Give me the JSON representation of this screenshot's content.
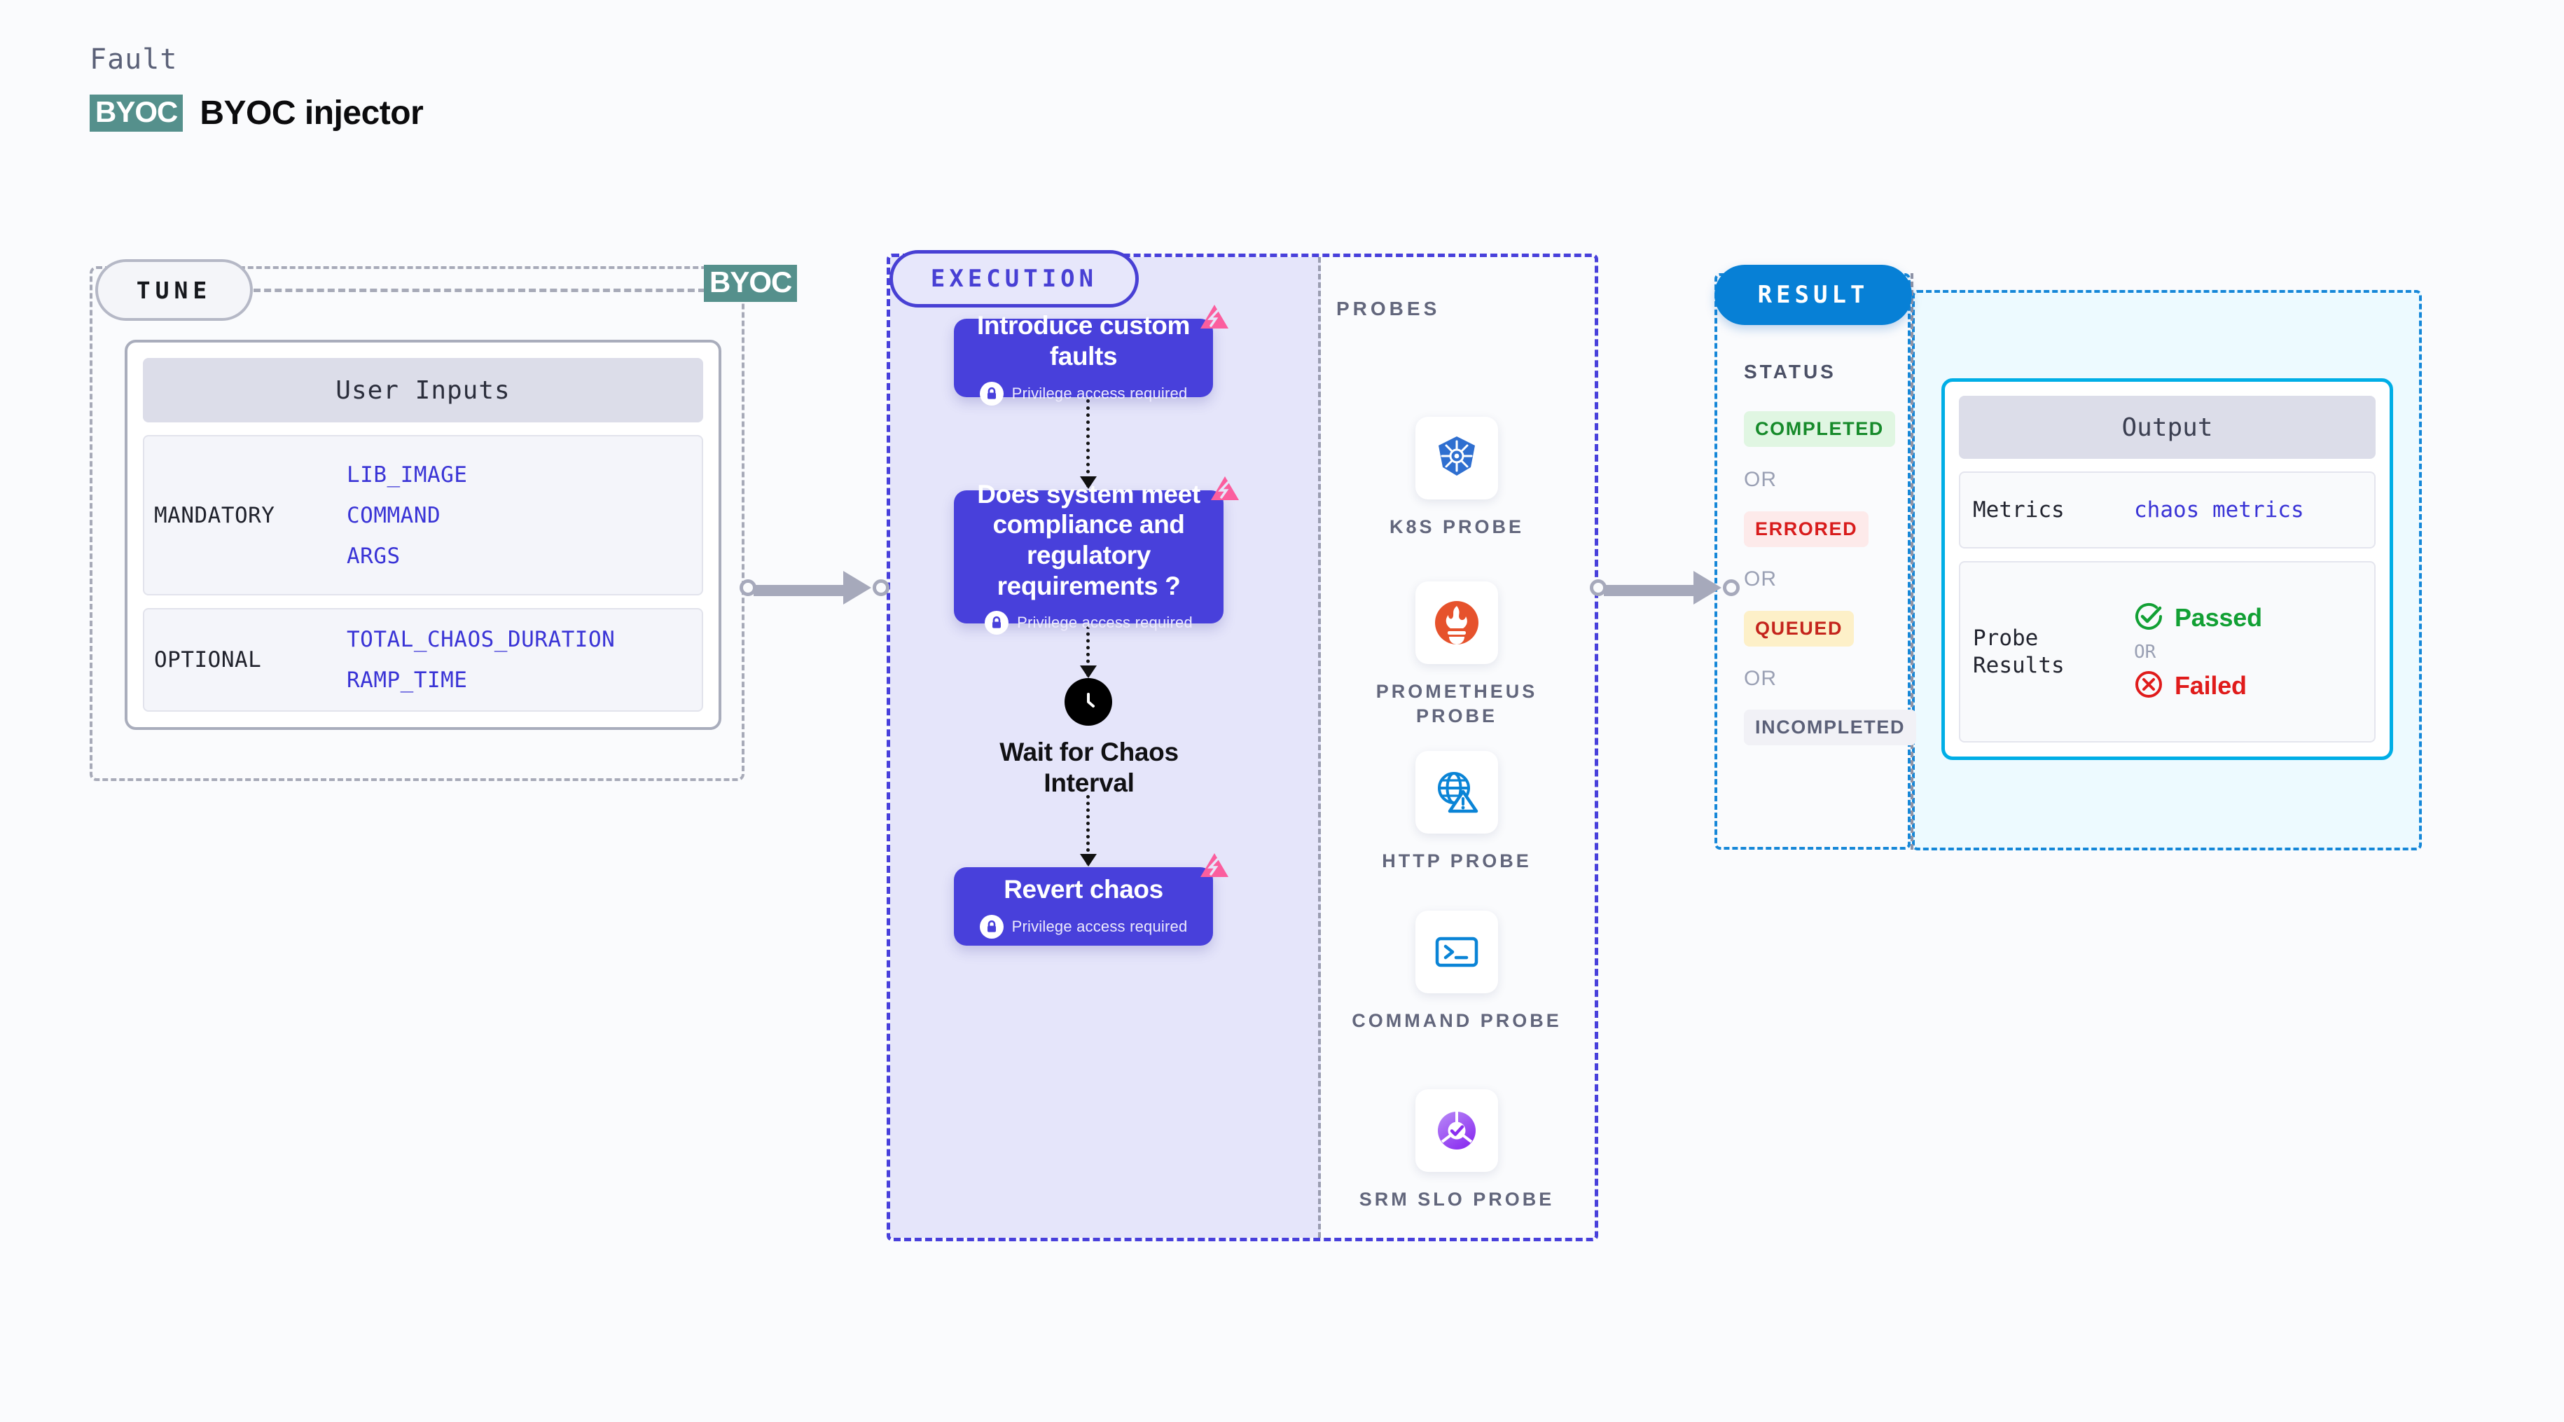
{
  "header": {
    "eyebrow": "Fault",
    "logo_badge": "BYOC",
    "title": "BYOC injector",
    "logo_color": "#55908c"
  },
  "tune": {
    "pill_label": "TUNE",
    "edge_tag": "BYOC",
    "card_header": "User Inputs",
    "groups": [
      {
        "kind": "MANDATORY",
        "values": [
          "LIB_IMAGE",
          "COMMAND",
          "ARGS"
        ]
      },
      {
        "kind": "OPTIONAL",
        "values": [
          "TOTAL_CHAOS_DURATION",
          "RAMP_TIME"
        ]
      }
    ],
    "value_color": "#3a34d6"
  },
  "execution": {
    "pill_label": "EXECUTION",
    "accent_color": "#4840db",
    "privilege_note": "Privilege access required",
    "nodes": [
      {
        "title": "Introduce custom faults",
        "privileged": true,
        "chaos_tag": true
      },
      {
        "title": "Does system meet compliance and regulatory requirements ?",
        "privileged": true,
        "chaos_tag": true
      },
      {
        "title": "Revert chaos",
        "privileged": true,
        "chaos_tag": true
      }
    ],
    "wait_step": {
      "label": "Wait for Chaos Interval",
      "icon": "clock-icon"
    }
  },
  "probes": {
    "section_label": "PROBES",
    "items": [
      {
        "label": "K8S PROBE",
        "icon": "kubernetes-icon",
        "color": "#2f6fd0"
      },
      {
        "label": "PROMETHEUS PROBE",
        "icon": "prometheus-icon",
        "color": "#e6522c"
      },
      {
        "label": "HTTP PROBE",
        "icon": "http-globe-alert-icon",
        "color": "#0a84d6"
      },
      {
        "label": "COMMAND PROBE",
        "icon": "terminal-icon",
        "color": "#0a84d6"
      },
      {
        "label": "SRM SLO PROBE",
        "icon": "srm-slo-icon",
        "color": "#8b3ff0"
      }
    ]
  },
  "result": {
    "pill_label": "RESULT",
    "pill_color": "#0780d6",
    "status_label": "STATUS",
    "or_text": "OR",
    "statuses": [
      {
        "text": "COMPLETED",
        "bg": "#e0f6e2",
        "fg": "#168a2a"
      },
      {
        "text": "ERRORED",
        "bg": "#fdeaea",
        "fg": "#d81c1c"
      },
      {
        "text": "QUEUED",
        "bg": "#fdf0c8",
        "fg": "#c4241c"
      },
      {
        "text": "INCOMPLETED",
        "bg": "#f1f1f6",
        "fg": "#5b6078"
      }
    ]
  },
  "output": {
    "header": "Output",
    "metrics_key": "Metrics",
    "metrics_value": "chaos metrics",
    "probe_results_key": "Probe Results",
    "passed_text": "Passed",
    "failed_text": "Failed",
    "or_text": "OR",
    "border_color": "#00aee6"
  }
}
